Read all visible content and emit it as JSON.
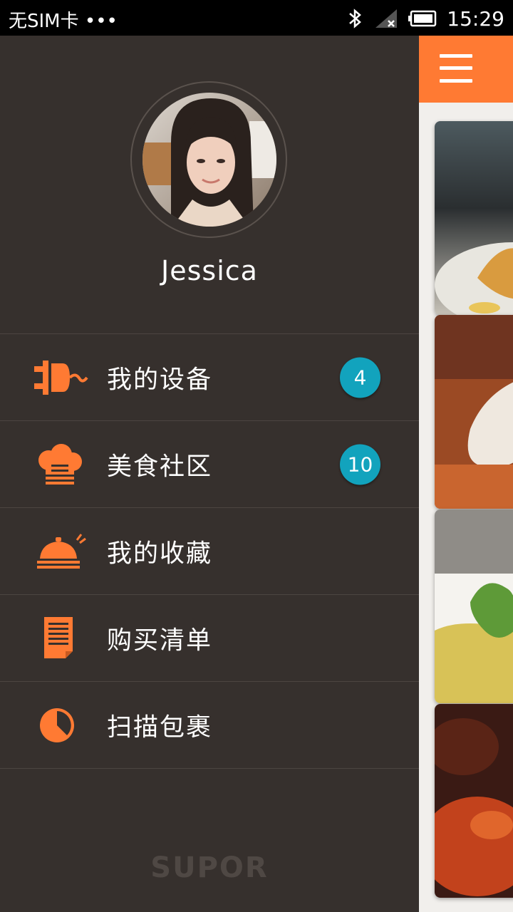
{
  "status_bar": {
    "carrier": "无SIM卡 •••",
    "time": "15:29",
    "icons": [
      "bluetooth-icon",
      "signal-icon",
      "battery-icon"
    ]
  },
  "drawer": {
    "username": "Jessica",
    "avatar": "profile-photo",
    "items": [
      {
        "label": "我的设备",
        "icon": "plug-icon",
        "badge": "4"
      },
      {
        "label": "美食社区",
        "icon": "chef-hat-icon",
        "badge": "10"
      },
      {
        "label": "我的收藏",
        "icon": "cloche-icon",
        "badge": ""
      },
      {
        "label": "购买清单",
        "icon": "list-icon",
        "badge": ""
      },
      {
        "label": "扫描包裹",
        "icon": "pie-icon",
        "badge": ""
      }
    ],
    "brand": "SUPOR"
  },
  "colors": {
    "accent": "#ff7a33",
    "drawer_bg": "#36302d",
    "badge": "#12a3bd"
  }
}
